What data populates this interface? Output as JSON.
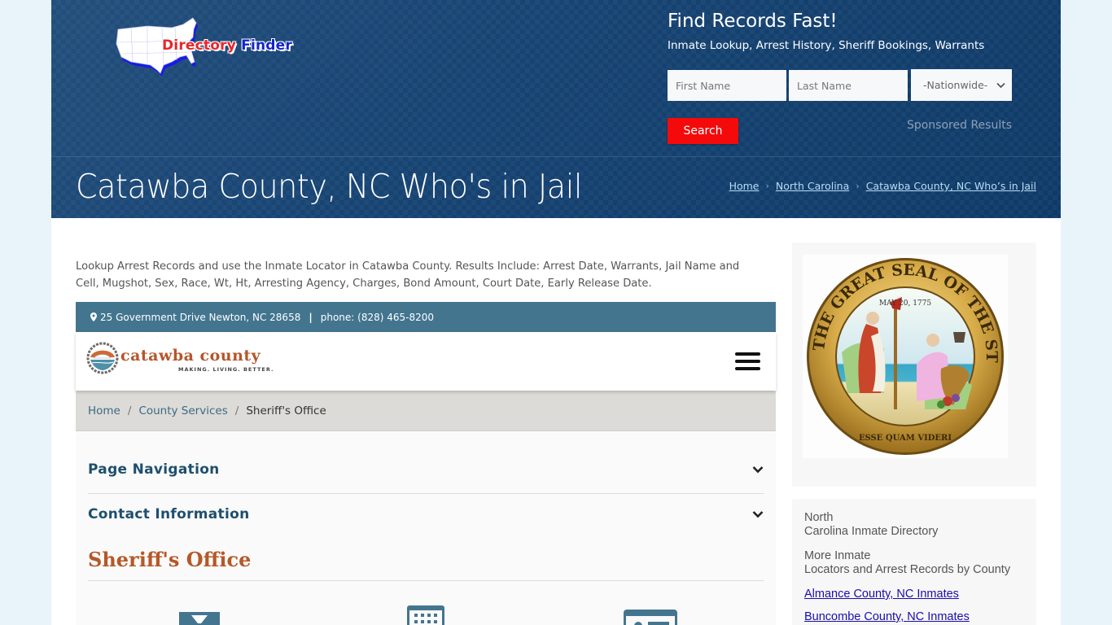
{
  "header": {
    "logo": {
      "word1": "Directory",
      "word2": "Finder"
    },
    "search": {
      "title": "Find Records Fast!",
      "subtitle": "Inmate Lookup, Arrest History, Sheriff Bookings, Warrants",
      "first_name_placeholder": "First Name",
      "last_name_placeholder": "Last Name",
      "state_selected": "-Nationwide-",
      "button_label": "Search",
      "sponsored_label": "Sponsored Results"
    },
    "page_title": "Catawba County, NC Who's in Jail",
    "breadcrumb": [
      {
        "label": "Home"
      },
      {
        "label": "North Carolina"
      },
      {
        "label": "Catawba County, NC Who’s in Jail"
      }
    ]
  },
  "main": {
    "intro": "Lookup Arrest Records and use the Inmate Locator in Catawba County. Results Include: Arrest Date, Warrants, Jail Name and Cell, Mugshot, Sex, Race, Wt, Ht, Arresting Agency, Charges, Bond Amount, Court Date, Early Release Date.",
    "contact": {
      "address": "25 Government Drive Newton, NC 28658",
      "separator": "|",
      "phone": "phone: (828) 465-8200"
    },
    "county_site": {
      "logo_word": "catawba county",
      "logo_tagline": "MAKING. LIVING. BETTER.",
      "breadcrumb": [
        {
          "label": "Home"
        },
        {
          "label": "County Services"
        },
        {
          "label": "Sheriff's Office"
        }
      ],
      "breadcrumb_sep": "/",
      "accordions": [
        {
          "label": "Page Navigation"
        },
        {
          "label": "Contact Information"
        }
      ],
      "section_title": "Sheriff's Office",
      "service_icons": [
        "hourglass-icon",
        "calendar-icon",
        "id-card-icon"
      ]
    }
  },
  "sidebar": {
    "seal_alt": "The Great Seal of the State of North Carolina",
    "seal_texts": {
      "ring": "THE GREAT SEAL OF THE STATE OF NORTH CAROLINA",
      "date": "MAY 20, 1775",
      "motto": "ESSE QUAM VIDERI"
    },
    "directory_title": "North\nCarolina Inmate Directory",
    "directory_title_l1": "North",
    "directory_title_l2": "Carolina Inmate Directory",
    "more_l1": "More Inmate",
    "more_l2": "Locators and Arrest Records by County",
    "links": [
      {
        "label": "Almance County, NC Inmates"
      },
      {
        "label": "Buncombe County, NC Inmates"
      }
    ]
  },
  "colors": {
    "header_bg": "#123f6d",
    "search_button": "#f40a0a",
    "contact_bar": "#43758f",
    "county_heading": "#b65828",
    "accordion_label": "#1e4f6d",
    "link": "#1a0dab",
    "page_outer_bg": "#e8f3fa"
  }
}
